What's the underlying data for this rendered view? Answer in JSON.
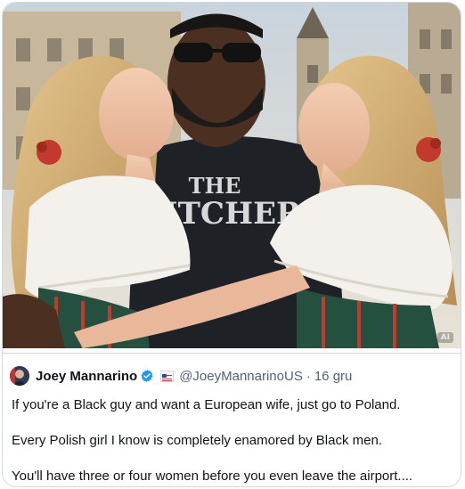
{
  "media": {
    "shirt_text_line1": "THE",
    "shirt_text_line2": "ITCHER",
    "watermark": "AI"
  },
  "quoted_post": {
    "author_name": "Joey Mannarino",
    "handle": "@JoeyMannarinoUS",
    "separator": "·",
    "time": "16 gru",
    "verified_icon": "verified-badge-icon",
    "paragraphs": [
      "If you're a Black guy and want a European wife, just go to Poland.",
      "Every Polish girl I know is completely enamored by Black men.",
      "You'll have three or four women before you even leave the airport...."
    ]
  },
  "colors": {
    "border": "#cfd9de",
    "secondary_text": "#536471",
    "verified_blue": "#1d9bf0"
  }
}
